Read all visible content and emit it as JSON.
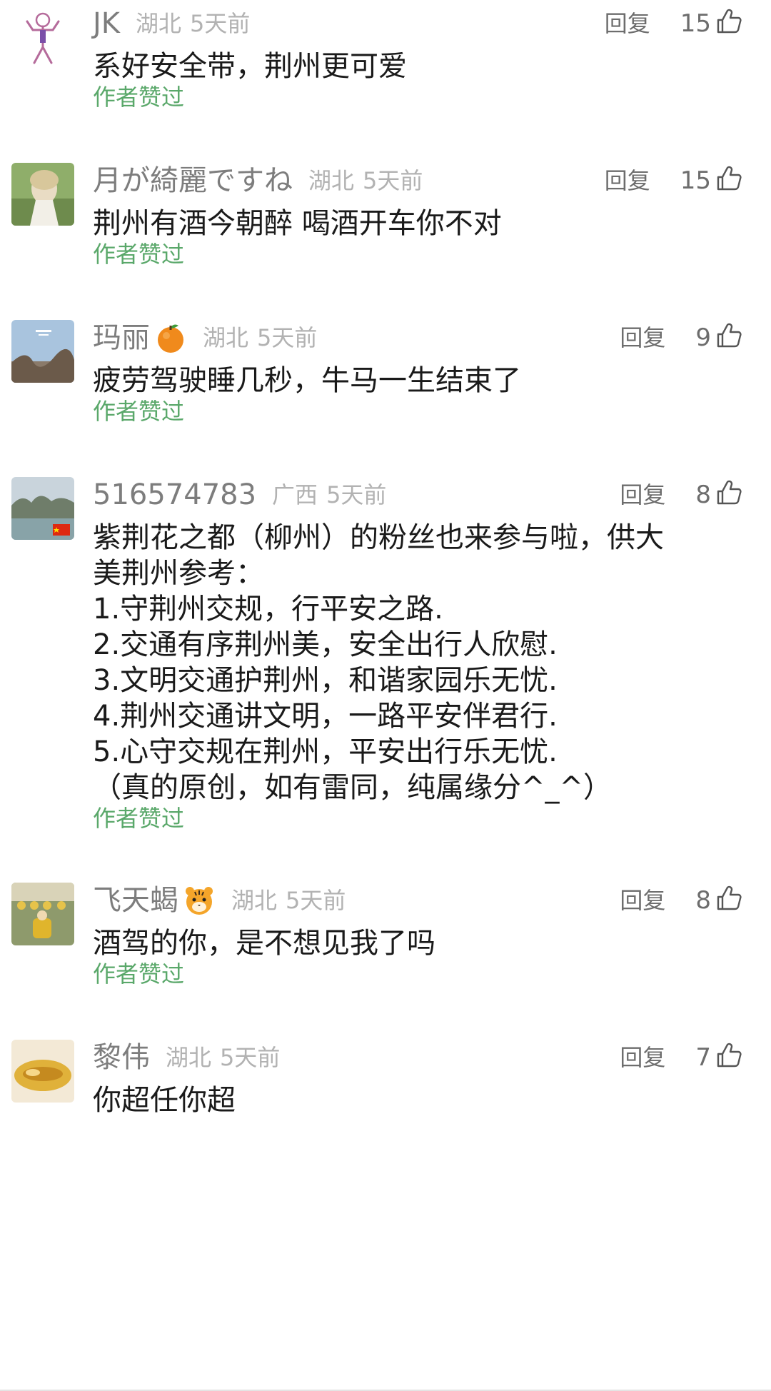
{
  "comments": [
    {
      "avatar": "cartoon-figure-avatar",
      "username": "JK",
      "emoji": "",
      "location": "湖北",
      "time": "5天前",
      "reply_label": "回复",
      "likes": "15",
      "text": [
        "系好安全带，荆州更可爱"
      ],
      "author_liked": "作者赞过"
    },
    {
      "avatar": "portrait-photo-avatar",
      "username": "月が綺麗ですね",
      "emoji": "",
      "location": "湖北",
      "time": "5天前",
      "reply_label": "回复",
      "likes": "15",
      "text": [
        "荆州有酒今朝醉 喝酒开车你不对"
      ],
      "author_liked": "作者赞过"
    },
    {
      "avatar": "sky-photo-avatar",
      "username": "玛丽",
      "emoji": "orange-emoji",
      "location": "湖北",
      "time": "5天前",
      "reply_label": "回复",
      "likes": "9",
      "text": [
        "疲劳驾驶睡几秒，牛马一生结束了"
      ],
      "author_liked": "作者赞过"
    },
    {
      "avatar": "landscape-flag-avatar",
      "username": "516574783",
      "emoji": "",
      "location": "广西",
      "time": "5天前",
      "reply_label": "回复",
      "likes": "8",
      "text": [
        "紫荆花之都（柳州）的粉丝也来参与啦，供大",
        "美荆州参考：",
        "1.守荆州交规，行平安之路.",
        "2.交通有序荆州美，安全出行人欣慰.",
        "3.文明交通护荆州，和谐家园乐无忧.",
        "4.荆州交通讲文明，一路平安伴君行.",
        "5.心守交规在荆州，平安出行乐无忧.",
        "（真的原创，如有雷同，纯属缘分^_^）"
      ],
      "author_liked": "作者赞过"
    },
    {
      "avatar": "group-photo-avatar",
      "username": "飞天蝎",
      "emoji": "tiger-emoji",
      "location": "湖北",
      "time": "5天前",
      "reply_label": "回复",
      "likes": "8",
      "text": [
        "酒驾的你，是不想见我了吗"
      ],
      "author_liked": "作者赞过"
    },
    {
      "avatar": "hand-photo-avatar",
      "username": "黎伟",
      "emoji": "",
      "location": "湖北",
      "time": "5天前",
      "reply_label": "回复",
      "likes": "7",
      "text": [
        "你超任你超"
      ],
      "author_liked": ""
    }
  ]
}
